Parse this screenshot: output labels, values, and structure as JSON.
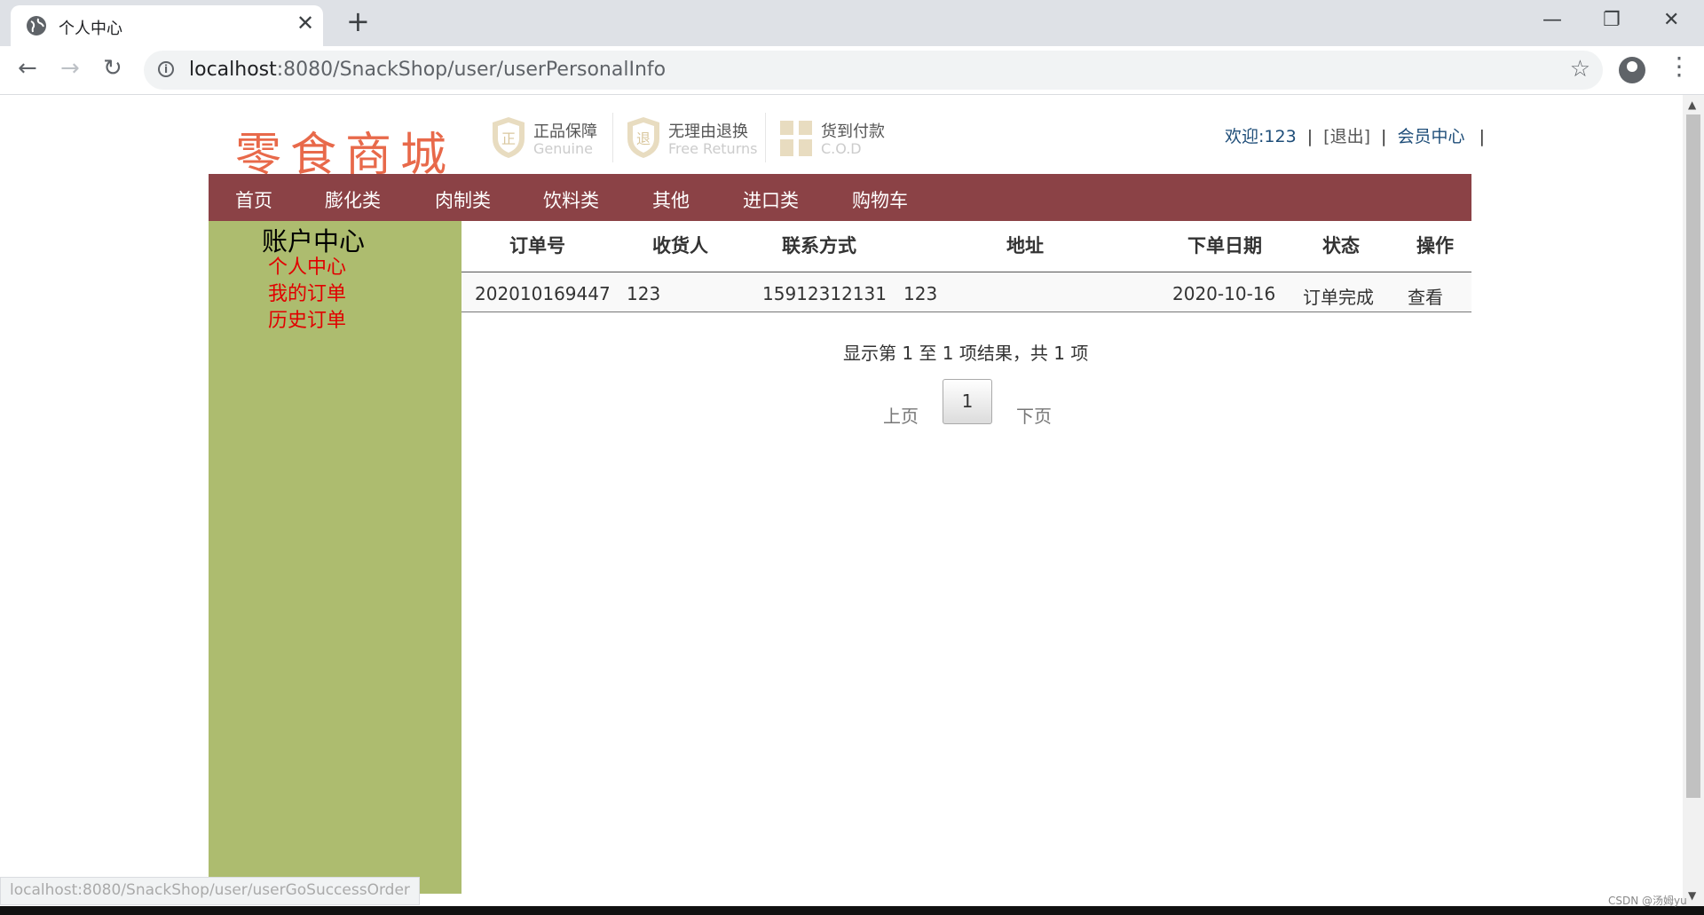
{
  "browser": {
    "tab_title": "个人中心",
    "tab_close": "✕",
    "new_tab": "+",
    "url_host": "localhost",
    "url_path": ":8080/SnackShop/user/userPersonalInfo",
    "minimize": "—",
    "restore": "❐",
    "close": "✕"
  },
  "header": {
    "logo_text": "零食商城",
    "badges": [
      {
        "title": "正品保障",
        "sub": "Genuine",
        "icon": "shield-icon"
      },
      {
        "title": "无理由退换",
        "sub": "Free Returns",
        "icon": "return-icon"
      },
      {
        "title": "货到付款",
        "sub": "C.O.D",
        "icon": "gift-icon"
      }
    ],
    "welcome": "欢迎:123",
    "sep": "|",
    "logout": "[退出]",
    "member_center": "会员中心"
  },
  "nav": {
    "items": [
      "首页",
      "膨化类",
      "肉制类",
      "饮料类",
      "其他",
      "进口类",
      "购物车"
    ]
  },
  "sidebar": {
    "title": "账户中心",
    "links": [
      "个人中心",
      "我的订单",
      "历史订单"
    ]
  },
  "orders": {
    "headers": [
      "订单号",
      "收货人",
      "联系方式",
      "地址",
      "下单日期",
      "状态",
      "操作"
    ],
    "rows": [
      {
        "order_no": "202010169447",
        "receiver": "123",
        "phone": "15912312131",
        "address": "123",
        "date": "2020-10-16",
        "status": "订单完成",
        "action": "查看"
      }
    ],
    "info": "显示第 1 至 1 项结果，共 1 项",
    "prev": "上页",
    "current_page": "1",
    "next": "下页"
  },
  "status_bar": "localhost:8080/SnackShop/user/userGoSuccessOrder",
  "watermark": "CSDN @汤姆yu",
  "colors": {
    "nav_bg": "#8b4246",
    "sidebar_bg": "#adbc6f",
    "sidebar_link": "#e10000",
    "logo": "#e8694a"
  }
}
